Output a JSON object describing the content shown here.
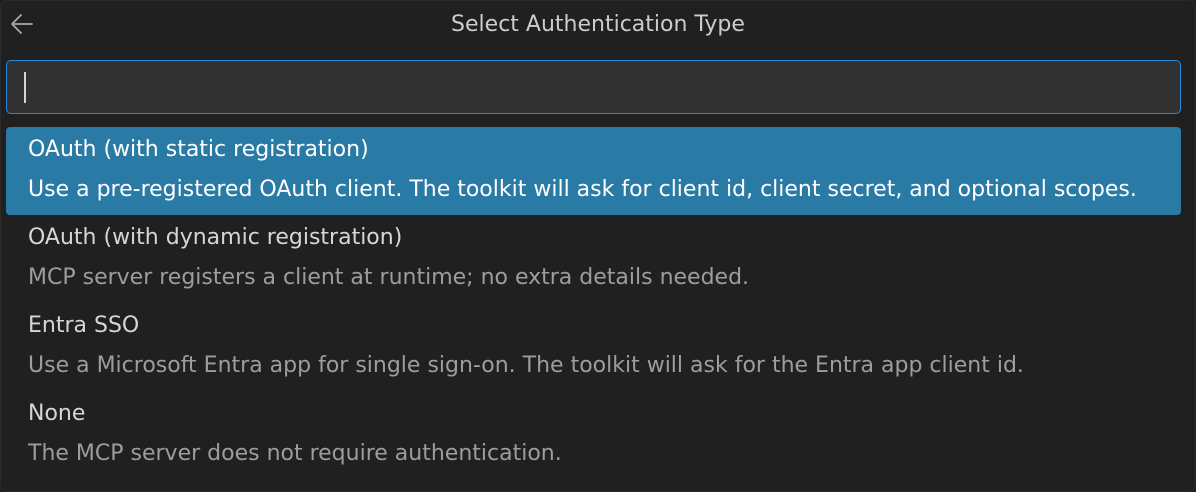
{
  "header": {
    "title": "Select Authentication Type",
    "back_icon": "arrow-left-icon"
  },
  "search": {
    "value": "",
    "placeholder": ""
  },
  "colors": {
    "accent": "#2488db",
    "selected_background": "#2a7aa6",
    "background": "#202020"
  },
  "items": [
    {
      "label": "OAuth (with static registration)",
      "description": "Use a pre-registered OAuth client. The toolkit will ask for client id, client secret, and optional scopes.",
      "selected": true
    },
    {
      "label": "OAuth (with dynamic registration)",
      "description": "MCP server registers a client at runtime; no extra details needed.",
      "selected": false
    },
    {
      "label": "Entra SSO",
      "description": "Use a Microsoft Entra app for single sign-on. The toolkit will ask for the Entra app client id.",
      "selected": false
    },
    {
      "label": "None",
      "description": "The MCP server does not require authentication.",
      "selected": false
    }
  ]
}
